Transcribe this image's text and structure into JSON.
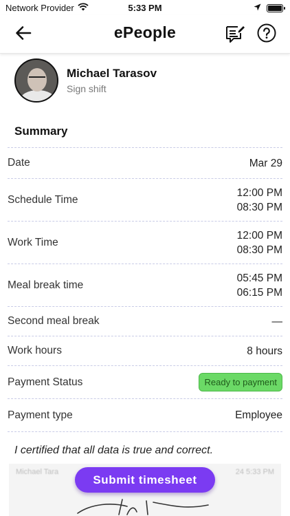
{
  "status_bar": {
    "carrier": "Network Provider",
    "time": "5:33 PM"
  },
  "header": {
    "title": "ePeople",
    "icons": [
      "back-arrow-icon",
      "notes-edit-icon",
      "help-icon"
    ]
  },
  "profile": {
    "name": "Michael Tarasov",
    "subtitle": "Sign shift"
  },
  "summary": {
    "title": "Summary",
    "date": {
      "label": "Date",
      "value": "Mar 29"
    },
    "schedule_time": {
      "label": "Schedule Time",
      "start": "12:00 PM",
      "end": "08:30 PM"
    },
    "work_time": {
      "label": "Work Time",
      "start": "12:00 PM",
      "end": "08:30 PM"
    },
    "meal_break": {
      "label": "Meal break time",
      "start": "05:45 PM",
      "end": "06:15 PM"
    },
    "second_meal_break": {
      "label": "Second meal break",
      "value": "—"
    },
    "work_hours": {
      "label": "Work hours",
      "value": "8 hours"
    },
    "payment_status": {
      "label": "Payment Status",
      "value": "Ready to payment",
      "color": "#6bd966"
    },
    "payment_type": {
      "label": "Payment type",
      "value": "Employee"
    }
  },
  "certification": {
    "text": "I certified that all data is true and correct.",
    "signature_meta_name": "Michael Tara",
    "signature_meta_date": "24 5:33 PM"
  },
  "actions": {
    "submit_label": "Submit timesheet",
    "accent_color": "#7b3bf2"
  }
}
